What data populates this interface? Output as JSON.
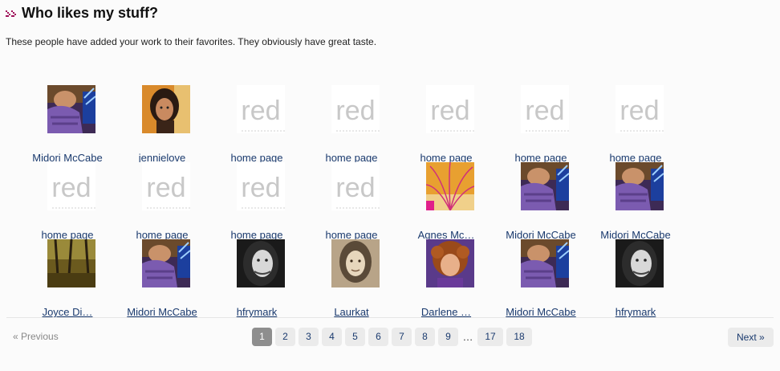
{
  "header": {
    "title": "Who likes my stuff?"
  },
  "subtitle": "These people have added your work to their favorites. They obviously have great taste.",
  "placeholder_text": "red",
  "grid": [
    [
      {
        "name": "Midori McCabe",
        "avatar": "purple-hands"
      },
      {
        "name": "jennielove",
        "avatar": "girl-portrait"
      },
      {
        "name": "home page",
        "avatar": "redbubble-placeholder"
      },
      {
        "name": "home page",
        "avatar": "redbubble-placeholder"
      },
      {
        "name": "home page",
        "avatar": "redbubble-placeholder"
      },
      {
        "name": "home page",
        "avatar": "redbubble-placeholder"
      },
      {
        "name": "home page",
        "avatar": "redbubble-placeholder"
      }
    ],
    [
      {
        "name": "home page",
        "avatar": "redbubble-placeholder"
      },
      {
        "name": "home page",
        "avatar": "redbubble-placeholder"
      },
      {
        "name": "home page",
        "avatar": "redbubble-placeholder"
      },
      {
        "name": "home page",
        "avatar": "redbubble-placeholder"
      },
      {
        "name": "Agnes Mc…",
        "avatar": "orange-abstract"
      },
      {
        "name": "Midori McCabe",
        "avatar": "purple-hands"
      },
      {
        "name": "Midori McCabe",
        "avatar": "purple-hands"
      }
    ],
    [
      {
        "name": "Joyce Di…",
        "avatar": "forest-photo"
      },
      {
        "name": "Midori McCabe",
        "avatar": "purple-hands"
      },
      {
        "name": "hfrymark",
        "avatar": "bw-woman-portrait"
      },
      {
        "name": "Laurkat",
        "avatar": "sepia-woman-portrait"
      },
      {
        "name": "Darlene …",
        "avatar": "curly-hair-portrait"
      },
      {
        "name": "Midori McCabe",
        "avatar": "purple-hands"
      },
      {
        "name": "hfrymark",
        "avatar": "bw-woman-portrait"
      }
    ]
  ],
  "pagination": {
    "previous_label": "« Previous",
    "next_label": "Next »",
    "pages": [
      "1",
      "2",
      "3",
      "4",
      "5",
      "6",
      "7",
      "8",
      "9"
    ],
    "current": "1",
    "ellipsis": "…",
    "last_pages": [
      "17",
      "18"
    ]
  },
  "colors": {
    "link": "#1a3a6e",
    "current_page_bg": "#8e8e8e",
    "page_bg": "#ebebeb",
    "bullet": "#a0115a"
  }
}
